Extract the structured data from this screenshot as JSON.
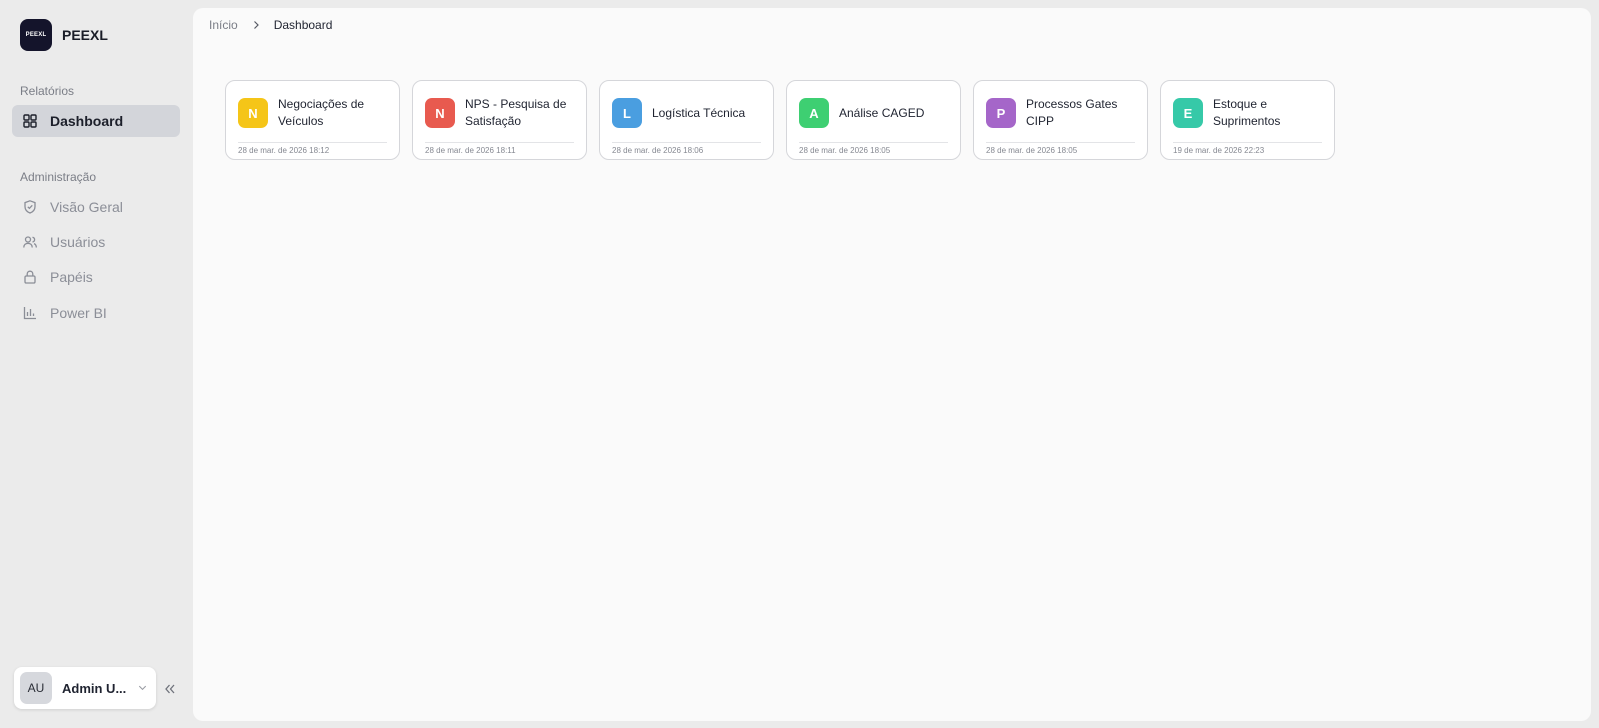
{
  "brand": {
    "logo_text": "PEEXL",
    "name": "PEEXL"
  },
  "sidebar": {
    "sections": [
      {
        "label": "Relatórios"
      },
      {
        "label": "Administração"
      }
    ],
    "items": [
      {
        "label": "Dashboard",
        "icon": "dashboard-grid-icon",
        "active": true
      },
      {
        "label": "Visão Geral",
        "icon": "shield-check-icon",
        "active": false
      },
      {
        "label": "Usuários",
        "icon": "users-icon",
        "active": false
      },
      {
        "label": "Papéis",
        "icon": "lock-icon",
        "active": false
      },
      {
        "label": "Power BI",
        "icon": "bar-chart-icon",
        "active": false
      }
    ],
    "user": {
      "initials": "AU",
      "name": "Admin U..."
    }
  },
  "breadcrumb": {
    "home": "Início",
    "current": "Dashboard"
  },
  "cards": [
    {
      "letter": "N",
      "title": "Negociações de Veículos",
      "date": "28 de mar. de 2026 18:12",
      "color": "#f5c518"
    },
    {
      "letter": "N",
      "title": "NPS - Pesquisa de Satisfação",
      "date": "28 de mar. de 2026 18:11",
      "color": "#e85a4f"
    },
    {
      "letter": "L",
      "title": "Logística Técnica",
      "date": "28 de mar. de 2026 18:06",
      "color": "#4a9ee0"
    },
    {
      "letter": "A",
      "title": "Análise CAGED",
      "date": "28 de mar. de 2026 18:05",
      "color": "#3ecf72"
    },
    {
      "letter": "P",
      "title": "Processos Gates CIPP",
      "date": "28 de mar. de 2026 18:05",
      "color": "#a566c9"
    },
    {
      "letter": "E",
      "title": "Estoque e Suprimentos",
      "date": "19 de mar. de 2026 22:23",
      "color": "#36c9a8"
    }
  ]
}
